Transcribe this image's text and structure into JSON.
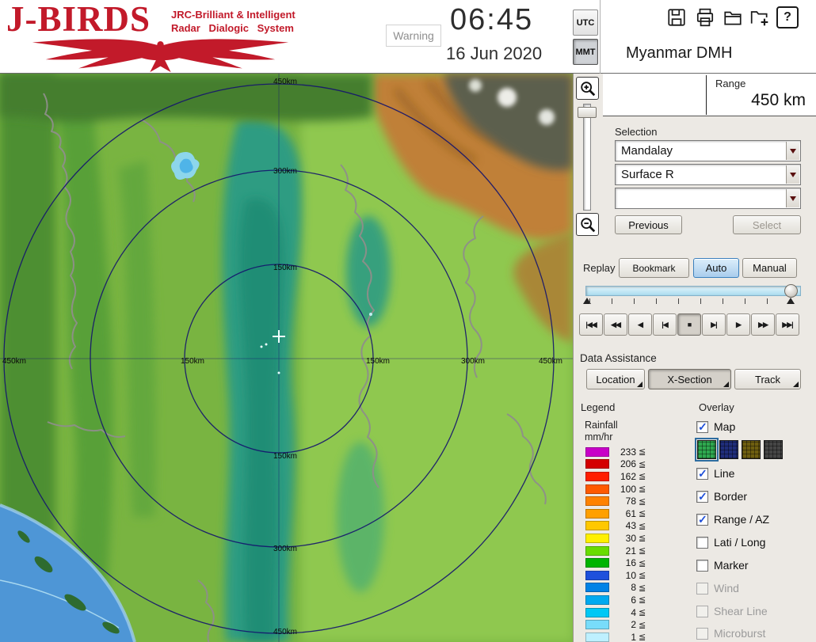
{
  "header": {
    "logo_title": "J-BIRDS",
    "logo_sub1": "JRC-Brilliant & Intelligent",
    "logo_sub2": "Radar Dialogic System",
    "warning": "Warning",
    "time": "06:45",
    "date": "16 Jun 2020",
    "utc": "UTC",
    "mmt": "MMT",
    "mmt_selected": true,
    "station": "Myanmar DMH",
    "help_glyph": "?"
  },
  "range": {
    "label": "Range",
    "value": "450 km"
  },
  "selection": {
    "label": "Selection",
    "site": "Mandalay",
    "product": "Surface R",
    "extra": "",
    "previous": "Previous",
    "select": "Select",
    "select_disabled": true
  },
  "replay": {
    "label": "Replay",
    "bookmark": "Bookmark",
    "auto": "Auto",
    "auto_selected": true,
    "manual": "Manual",
    "stop_pressed": true,
    "playback": [
      "|◀◀",
      "◀◀",
      "◀",
      "|◀",
      "■",
      "▶|",
      "▶",
      "▶▶",
      "▶▶|"
    ]
  },
  "assist": {
    "label": "Data Assistance",
    "location": "Location",
    "xsection": "X-Section",
    "xsection_pressed": true,
    "track": "Track"
  },
  "legend": {
    "label": "Legend",
    "unit1": "Rainfall",
    "unit2": "mm/hr",
    "suffix": "≦",
    "items": [
      {
        "v": "233",
        "c": "#C800C8"
      },
      {
        "v": "206",
        "c": "#D40000"
      },
      {
        "v": "162",
        "c": "#FF1E00"
      },
      {
        "v": "100",
        "c": "#FF5A00"
      },
      {
        "v": "78",
        "c": "#FF8200"
      },
      {
        "v": "61",
        "c": "#FFA000"
      },
      {
        "v": "43",
        "c": "#FFC800"
      },
      {
        "v": "30",
        "c": "#FFF000"
      },
      {
        "v": "21",
        "c": "#69DC00"
      },
      {
        "v": "16",
        "c": "#00B400"
      },
      {
        "v": "10",
        "c": "#1E50DC"
      },
      {
        "v": "8",
        "c": "#0082E6"
      },
      {
        "v": "6",
        "c": "#00AAF0"
      },
      {
        "v": "4",
        "c": "#00C8F5"
      },
      {
        "v": "2",
        "c": "#78DCFA"
      },
      {
        "v": "1",
        "c": "#BEF0FF"
      }
    ]
  },
  "overlay": {
    "label": "Overlay",
    "items": [
      {
        "label": "Map",
        "checked": true,
        "disabled": false
      },
      {
        "label": "Line",
        "checked": true,
        "disabled": false
      },
      {
        "label": "Border",
        "checked": true,
        "disabled": false
      },
      {
        "label": "Range / AZ",
        "checked": true,
        "disabled": false
      },
      {
        "label": "Lati / Long",
        "checked": false,
        "disabled": false
      },
      {
        "label": "Marker",
        "checked": false,
        "disabled": false
      },
      {
        "label": "Wind",
        "checked": false,
        "disabled": true
      },
      {
        "label": "Shear Line",
        "checked": false,
        "disabled": true
      },
      {
        "label": "Microburst",
        "checked": false,
        "disabled": true
      }
    ],
    "map_styles": [
      {
        "color": "#2FA84F",
        "selected": true
      },
      {
        "color": "#1F2D7A",
        "selected": false
      },
      {
        "color": "#6E5E10",
        "selected": false
      },
      {
        "color": "#454545",
        "selected": false
      }
    ]
  },
  "map": {
    "rings": [
      "450km",
      "300km",
      "150km",
      "150km",
      "300km",
      "450km",
      "450km",
      "150km",
      "150km",
      "300km",
      "450km"
    ]
  }
}
